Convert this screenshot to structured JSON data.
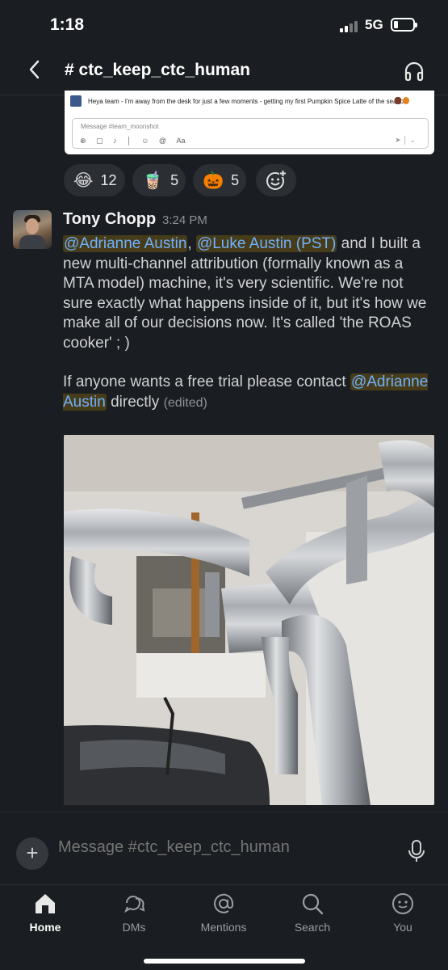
{
  "status_bar": {
    "time": "1:18",
    "network": "5G"
  },
  "header": {
    "channel_name": "# ctc_keep_ctc_human"
  },
  "embed": {
    "message_text": "Heya team - I'm away from the desk for just a few moments - getting my first Pumpkin Spice Latte of the season!",
    "composer_placeholder": "Message #team_moonshot",
    "composer_aa": "Aa"
  },
  "reactions": [
    {
      "emoji": "😂",
      "count": "12",
      "icon": "laughing-emoji"
    },
    {
      "emoji": "🧋",
      "count": "5",
      "icon": "latte-emoji"
    },
    {
      "emoji": "🎃",
      "count": "5",
      "icon": "pumpkin-emoji"
    }
  ],
  "message": {
    "author": "Tony Chopp",
    "timestamp": "3:24 PM",
    "mention_1": "@Adrianne Austin",
    "sep_1": ", ",
    "mention_2": "@Luke Austin (PST)",
    "text_1": " and I built a new multi-channel attribution (formally known as a MTA model) machine, it's very scientific. We're not sure exactly what happens inside of it, but it's how we make all of our decisions now. It's called 'the ROAS cooker'  ; )",
    "text_2": "If anyone wants a free trial please contact ",
    "mention_3": "@Adrianne Austin",
    "text_3": " directly",
    "edited_label": "(edited)"
  },
  "composer": {
    "placeholder": "Message #ctc_keep_ctc_human"
  },
  "tabs": [
    {
      "label": "Home",
      "icon": "home-icon",
      "active": true
    },
    {
      "label": "DMs",
      "icon": "dms-icon",
      "active": false
    },
    {
      "label": "Mentions",
      "icon": "mentions-icon",
      "active": false
    },
    {
      "label": "Search",
      "icon": "search-icon",
      "active": false
    },
    {
      "label": "You",
      "icon": "you-icon",
      "active": false
    }
  ],
  "colors": {
    "background": "#1a1d21",
    "mention_text": "#6fb1ff",
    "mention_highlight": "#e8ab00",
    "reaction_bg": "#2b2e33"
  }
}
